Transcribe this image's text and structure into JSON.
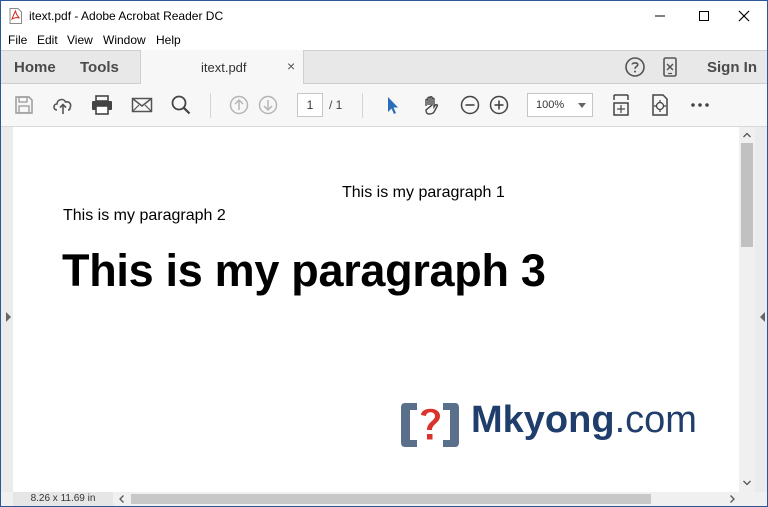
{
  "window": {
    "title": "itext.pdf - Adobe Acrobat Reader DC"
  },
  "menu": {
    "items": [
      "File",
      "Edit",
      "View",
      "Window",
      "Help"
    ]
  },
  "tabs": {
    "home": "Home",
    "tools": "Tools",
    "document": "itext.pdf",
    "close": "×",
    "sign_in": "Sign In"
  },
  "toolbar": {
    "current_page": "1",
    "page_total": "/ 1",
    "zoom": "100%"
  },
  "document": {
    "paragraph_1": "This is my paragraph 1",
    "paragraph_2": "This is my paragraph 2",
    "paragraph_3": "This is my paragraph 3",
    "logo": {
      "name": "Mkyong",
      "suffix": ".com",
      "colors": {
        "bracket": "#5a6f8a",
        "question": "#d9342b",
        "text": "#1f3e6b"
      }
    }
  },
  "status": {
    "page_size": "8.26 x 11.69 in"
  },
  "colors": {
    "accent_blue": "#2a6ebb",
    "tab_bar": "#e8e8e8",
    "toolbar": "#f7f7f7",
    "pdf_icon_red": "#d4271e"
  }
}
